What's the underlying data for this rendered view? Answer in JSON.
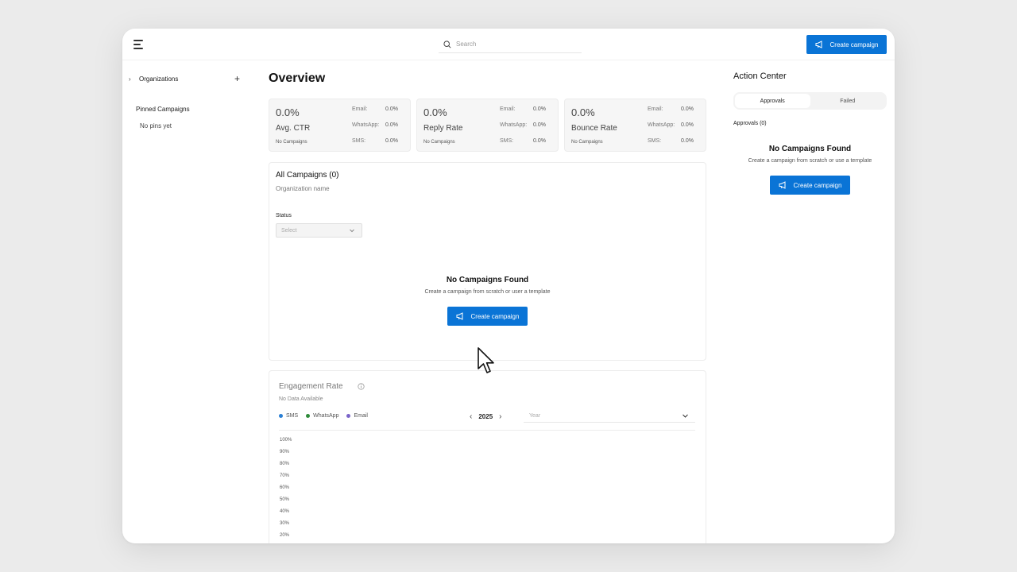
{
  "topbar": {
    "search_placeholder": "Search",
    "create_label": "Create campaign"
  },
  "sidebar": {
    "organizations_label": "Organizations",
    "pinned_title": "Pinned Campaigns",
    "pinned_empty": "No pins yet"
  },
  "main": {
    "title": "Overview",
    "stats": [
      {
        "value": "0.0%",
        "name": "Avg. CTR",
        "sub": "No Campaigns",
        "email_label": "Email:",
        "email_value": "0.0%",
        "whatsapp_label": "WhatsApp:",
        "whatsapp_value": "0.0%",
        "sms_label": "SMS:",
        "sms_value": "0.0%"
      },
      {
        "value": "0.0%",
        "name": "Reply Rate",
        "sub": "No Campaigns",
        "email_label": "Email:",
        "email_value": "0.0%",
        "whatsapp_label": "WhatsApp:",
        "whatsapp_value": "0.0%",
        "sms_label": "SMS:",
        "sms_value": "0.0%"
      },
      {
        "value": "0.0%",
        "name": "Bounce Rate",
        "sub": "No Campaigns",
        "email_label": "Email:",
        "email_value": "0.0%",
        "whatsapp_label": "WhatsApp:",
        "whatsapp_value": "0.0%",
        "sms_label": "SMS:",
        "sms_value": "0.0%"
      }
    ],
    "campaigns": {
      "title": "All Campaigns (0)",
      "subtitle": "Organization name",
      "status_label": "Status",
      "status_placeholder": "Select",
      "empty_title": "No Campaigns Found",
      "empty_sub": "Create a campaign from scratch or user a template",
      "create_label": "Create campaign"
    },
    "engagement": {
      "title": "Engagement Rate",
      "subtitle": "No Data Available",
      "legend": [
        {
          "label": "SMS",
          "color": "#2a7fd4"
        },
        {
          "label": "WhatsApp",
          "color": "#2e8b3a"
        },
        {
          "label": "Email",
          "color": "#7a64c9"
        }
      ],
      "year": "2025",
      "period_placeholder": "Year",
      "y_ticks": [
        "100%",
        "90%",
        "80%",
        "70%",
        "60%",
        "50%",
        "40%",
        "30%",
        "20%"
      ]
    }
  },
  "action_center": {
    "title": "Action Center",
    "tabs": [
      "Approvals",
      "Failed"
    ],
    "approvals_count": "Approvals (0)",
    "empty_title": "No Campaigns Found",
    "empty_sub": "Create a campaign from scratch or use a template",
    "create_label": "Create campaign"
  },
  "colors": {
    "primary": "#0a74d6"
  }
}
